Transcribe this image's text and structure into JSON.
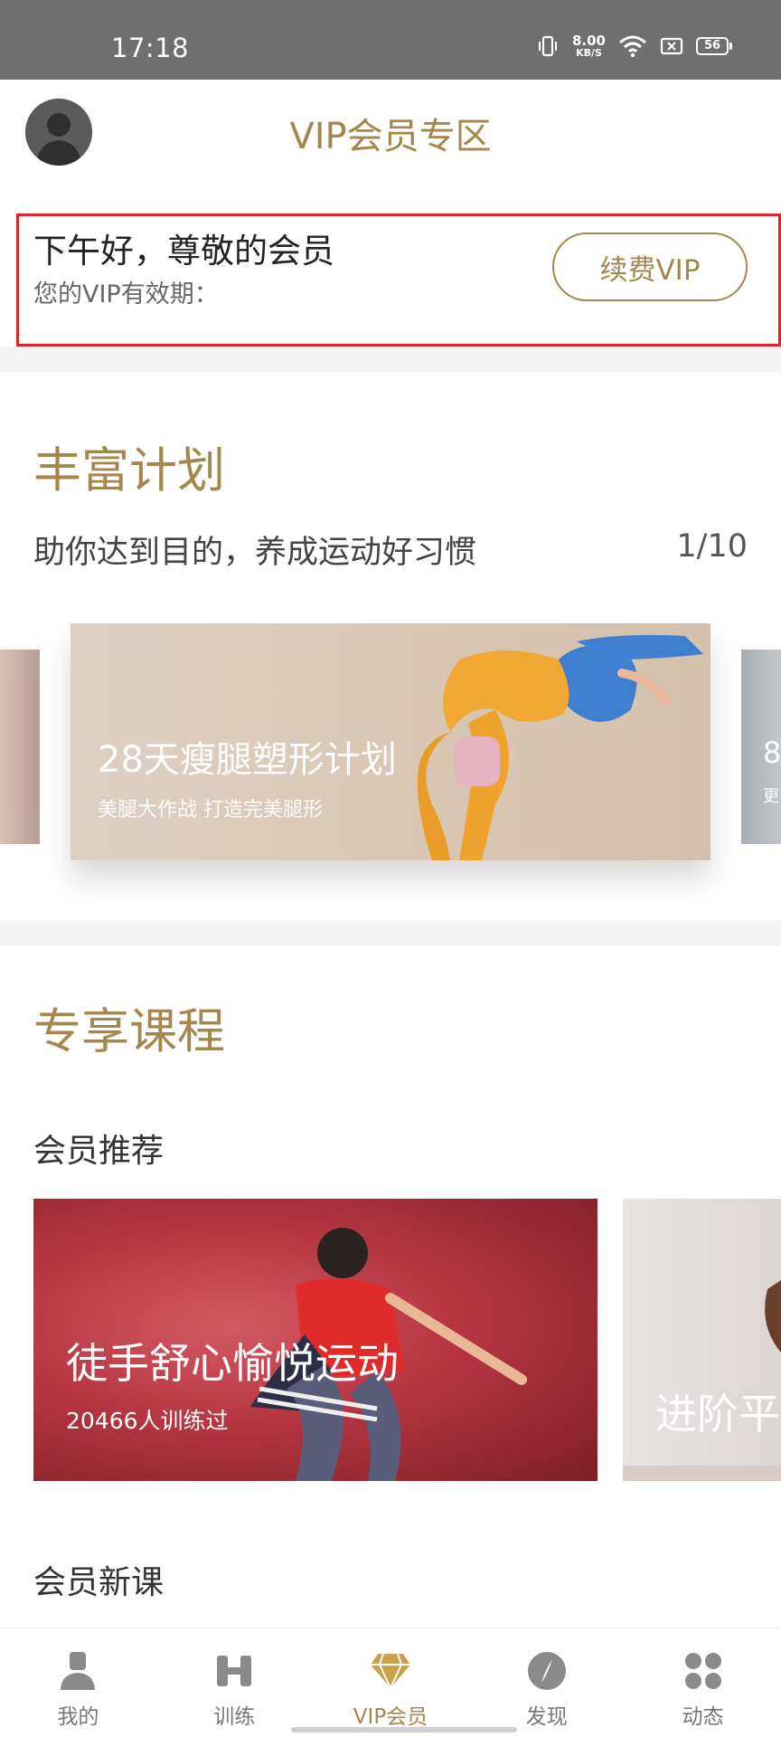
{
  "status_bar": {
    "time": "17:18",
    "net_speed": "8.00",
    "net_unit": "KB/S",
    "battery": "56"
  },
  "header": {
    "title": "VIP会员专区"
  },
  "member_card": {
    "greeting": "下午好，尊敬的会员",
    "validity_label": "您的VIP有效期：",
    "renew_button": "续费VIP"
  },
  "plans": {
    "title": "丰富计划",
    "subtitle": "助你达到目的，养成运动好习惯",
    "pager": "1/10",
    "card_title": "28天瘦腿塑形计划",
    "card_subtitle": "美腿大作战 打造完美腿形",
    "next_card_peek_title": "8",
    "next_card_peek_subtitle": "更"
  },
  "courses": {
    "title": "专享课程",
    "recommended_label": "会员推荐",
    "main_card_title": "徒手舒心愉悦运动",
    "main_card_count": "20466人训练过",
    "next_card_title": "进阶平",
    "new_courses_label": "会员新课"
  },
  "bottom_nav": {
    "items": [
      {
        "label": "我的",
        "icon": "person-icon"
      },
      {
        "label": "训练",
        "icon": "dumbbell-icon"
      },
      {
        "label": "VIP会员",
        "icon": "diamond-icon"
      },
      {
        "label": "发现",
        "icon": "compass-icon"
      },
      {
        "label": "动态",
        "icon": "grid-icon"
      }
    ],
    "active_index": 2
  },
  "colors": {
    "accent_gold": "#a5874d",
    "highlight_border": "#e0242d",
    "status_bar": "#6f6f6f"
  }
}
